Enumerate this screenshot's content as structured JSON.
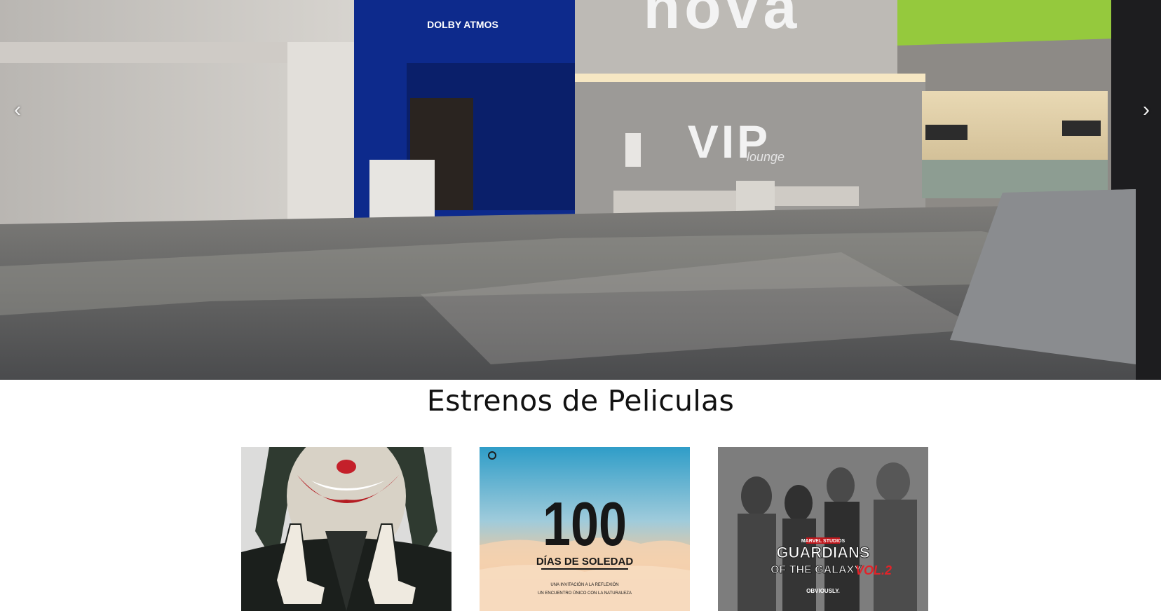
{
  "carousel": {
    "prev_icon": "chevron-left-icon",
    "next_icon": "chevron-right-icon",
    "prev_glyph": "‹",
    "next_glyph": "›",
    "slide": {
      "brand_sign": "nova",
      "vip_sign": "VIP",
      "vip_script": "lounge",
      "auditorium_sign": "DOLBY ATMOS"
    }
  },
  "section": {
    "title": "Estrenos de Peliculas"
  },
  "movies": [
    {
      "poster_kind": "joker"
    },
    {
      "poster_kind": "100-dias",
      "title_number": "100",
      "title_text": "DÍAS DE SOLEDAD",
      "tagline_1": "UNA INVITACIÓN A LA REFLEXIÓN",
      "tagline_2": "UN ENCUENTRO ÚNICO CON LA NATURALEZA"
    },
    {
      "poster_kind": "guardians",
      "studio": "MARVEL STUDIOS",
      "title_line_1": "GUARDIANS",
      "title_line_2": "OF THE GALAXY",
      "title_vol": "VOL.2",
      "tagline": "OBVIOUSLY."
    }
  ]
}
